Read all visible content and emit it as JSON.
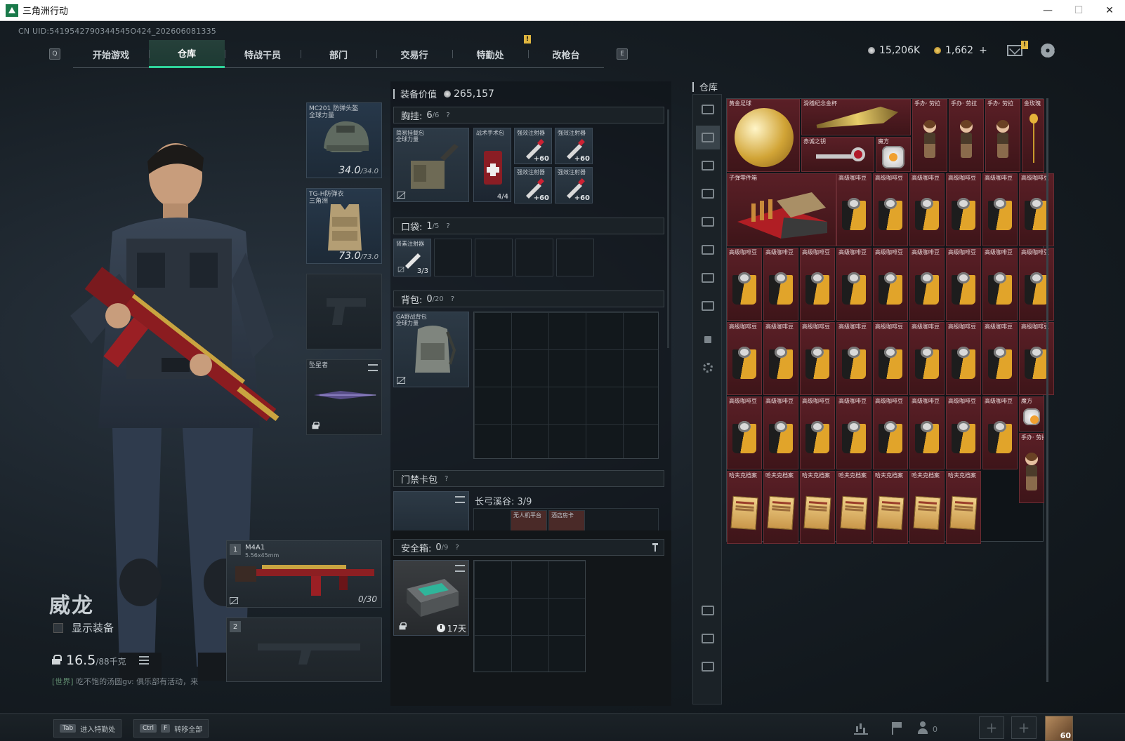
{
  "window": {
    "title": "三角洲行动",
    "minimize": "—",
    "maximize": "☐",
    "close": "✕"
  },
  "uid": "CN UID:5419542790344545O424_202606081335",
  "nav": {
    "left_key": "Q",
    "right_key": "E",
    "tabs": [
      {
        "label": "开始游戏",
        "active": false
      },
      {
        "label": "仓库",
        "active": true
      },
      {
        "label": "特战干员",
        "active": false
      },
      {
        "label": "部门",
        "active": false
      },
      {
        "label": "交易行",
        "active": false
      },
      {
        "label": "特勤处",
        "active": false
      },
      {
        "label": "改枪台",
        "active": false
      }
    ],
    "alert_badge": "!"
  },
  "currency": {
    "silver": "15,206K",
    "gold": "1,662",
    "gold_add": "+"
  },
  "mail_badge": "!",
  "character": {
    "name": "威龙",
    "show_gear_label": "显示装备",
    "weight": "16.5",
    "weight_max": "/88千克",
    "chat_channel": "[世界]",
    "chat_text": "吃不饱的汤圆gv: 俱乐部有活动，来"
  },
  "gear_slots": {
    "helmet": {
      "label": "MC201 防弹头盔",
      "sub": "全球力量",
      "dur": "34.0",
      "dur_max": "/34.0"
    },
    "armor": {
      "label": "TG-H防弹衣",
      "sub": "三角洲",
      "dur": "73.0",
      "dur_max": "/73.0"
    },
    "melee": {
      "label": "坠星者"
    }
  },
  "weapons": [
    {
      "num": "1",
      "name": "M4A1",
      "caliber": "5.56x45mm",
      "ammo": "0/30"
    },
    {
      "num": "2"
    }
  ],
  "equipment": {
    "value_label": "装备价值",
    "value": "265,157",
    "chest_rig": {
      "title": "胸挂:",
      "count": "6",
      "cap": "/6",
      "q": "?"
    },
    "chest_items": {
      "rig": {
        "label": "简易挂载包",
        "sub": "全球力量"
      },
      "medkit": {
        "label": "战术手术包",
        "count": "4/4"
      },
      "injectors": [
        {
          "label": "强效注射器",
          "count": "+60"
        },
        {
          "label": "强效注射器",
          "count": "+60"
        },
        {
          "label": "强效注射器",
          "count": "+60"
        },
        {
          "label": "强效注射器",
          "count": "+60"
        }
      ]
    },
    "pocket": {
      "title": "口袋:",
      "count": "1",
      "cap": "/5",
      "q": "?"
    },
    "pocket_item": {
      "label": "肾素注射器",
      "count": "3/3"
    },
    "backpack": {
      "title": "背包:",
      "count": "0",
      "cap": "/20",
      "q": "?"
    },
    "backpack_item": {
      "label": "GA野战背包",
      "sub": "全球力量"
    },
    "keycard": {
      "title": "门禁卡包",
      "q": "?",
      "map_label": "长弓溪谷: 3/9",
      "card1": "无人机平台",
      "card2": "酒店房卡"
    },
    "safebox": {
      "title": "安全箱:",
      "count": "0",
      "cap": "/9",
      "q": "?",
      "time": "17天"
    }
  },
  "warehouse": {
    "title": "仓库",
    "items": {
      "ball": "黄金足球",
      "sword": "滑稽纪念金杯",
      "key": "赤诚之钥",
      "cube": "魔方",
      "figure": "手办· 劳拉",
      "rose": "金玫瑰",
      "sculpture": "子弹零件箱",
      "bean": "高级咖啡豆",
      "folder": "哈夫克档案"
    }
  },
  "bottom": {
    "hint1_key": "Tab",
    "hint1_label": "进入特勤处",
    "hint2_key1": "Ctrl",
    "hint2_key2": "F",
    "hint2_label": "转移全部",
    "friends": "0",
    "plus": "+",
    "level": "60"
  }
}
